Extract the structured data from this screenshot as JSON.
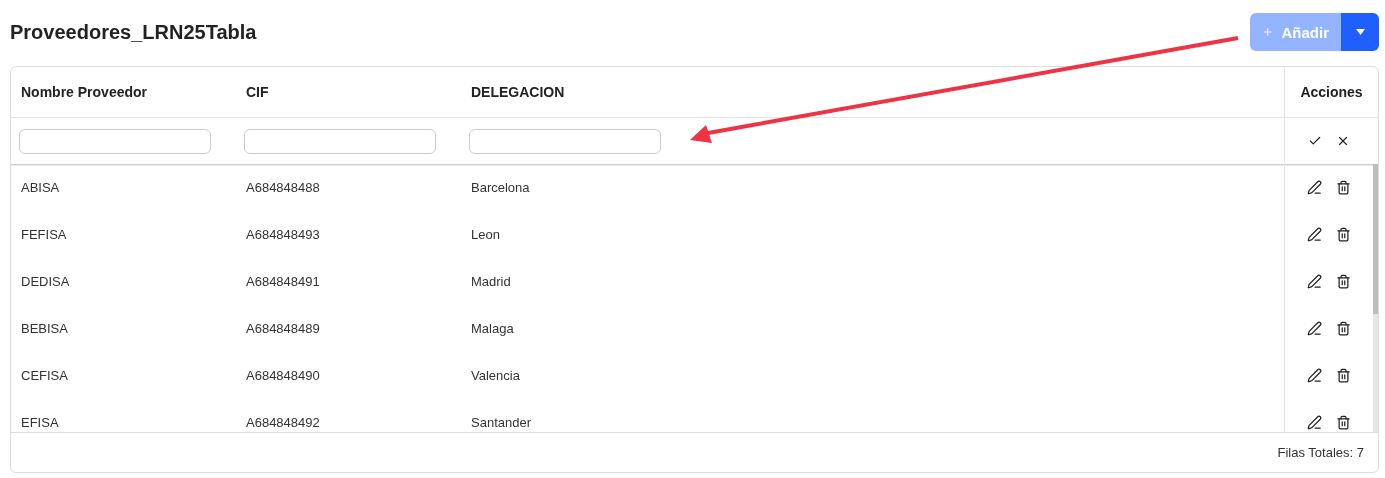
{
  "title": "Proveedores_LRN25Tabla",
  "add_button": {
    "label": "Añadir",
    "disabled": true
  },
  "table": {
    "columns": [
      {
        "label": "Nombre Proveedor"
      },
      {
        "label": "CIF"
      },
      {
        "label": "DELEGACION"
      }
    ],
    "actions_column": "Acciones",
    "rows": [
      {
        "cells": [
          "ABISA",
          "A684848488",
          "Barcelona"
        ]
      },
      {
        "cells": [
          "FEFISA",
          "A684848493",
          "Leon"
        ]
      },
      {
        "cells": [
          "DEDISA",
          "A684848491",
          "Madrid"
        ]
      },
      {
        "cells": [
          "BEBISA",
          "A684848489",
          "Malaga"
        ]
      },
      {
        "cells": [
          "CEFISA",
          "A684848490",
          "Valencia"
        ]
      },
      {
        "cells": [
          "EFISA",
          "A684848492",
          "Santander"
        ]
      }
    ],
    "footer": "Filas Totales: 7"
  }
}
